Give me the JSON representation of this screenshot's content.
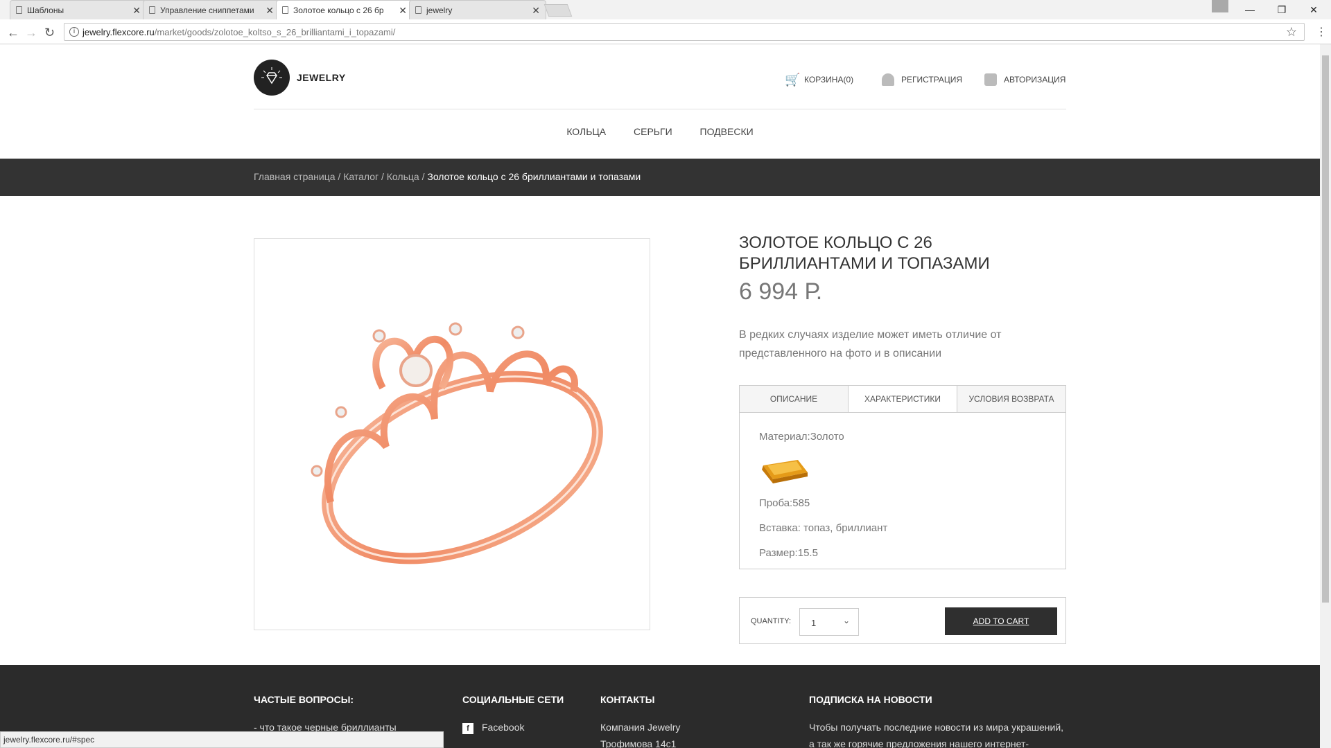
{
  "browser": {
    "tabs": [
      {
        "title": "Шаблоны",
        "active": false
      },
      {
        "title": "Управление сниппетами",
        "active": false
      },
      {
        "title": "Золотое кольцо с 26 бр",
        "active": true
      },
      {
        "title": "jewelry",
        "active": false
      }
    ],
    "url_host": "jewelry.flexcore.ru",
    "url_path": "/market/goods/zolotoe_koltso_s_26_brilliantami_i_topazami/",
    "status_url": "jewelry.flexcore.ru/#spec"
  },
  "header": {
    "logo_text": "JEWELRY",
    "cart": "КОРЗИНА(0)",
    "register": "РЕГИСТРАЦИЯ",
    "login": "АВТОРИЗАЦИЯ"
  },
  "nav": {
    "items": [
      "КОЛЬЦА",
      "СЕРЬГИ",
      "ПОДВЕСКИ"
    ]
  },
  "breadcrumb": {
    "home": "Главная страница",
    "catalog": "Каталог",
    "rings": "Кольца",
    "current": "Золотое кольцо с 26 бриллиантами и топазами",
    "sep": " / "
  },
  "product": {
    "title": "ЗОЛОТОЕ КОЛЬЦО С 26 БРИЛЛИАНТАМИ И ТОПАЗАМИ",
    "price": "6 994 Р.",
    "note": "В редких случаях изделие может иметь отличие от представленного на фото и в описании",
    "tabs": [
      "ОПИСАНИЕ",
      "ХАРАКТЕРИСТИКИ",
      "УСЛОВИЯ ВОЗВРАТА"
    ],
    "specs": {
      "material": "Материал:Золото",
      "proba": "Проба:585",
      "insert": "Вставка: топаз, бриллиант",
      "size": "Размер:15.5"
    },
    "quantity_label": "QUANTITY:",
    "quantity": "1",
    "add_to_cart": "ADD TO CART"
  },
  "footer": {
    "faq_title": "ЧАСТЫЕ ВОПРОСЫ:",
    "faq_item": "- что такое черные бриллианты",
    "social_title": "СОЦИАЛЬНЫЕ СЕТИ",
    "social_item": "Facebook",
    "contacts_title": "КОНТАКТЫ",
    "contacts_line1": "Компания Jewelry",
    "contacts_line2": "Трофимова 14с1",
    "news_title": "ПОДПИСКА НА НОВОСТИ",
    "news_line1": "Чтобы получать последние новости из мира украшений,",
    "news_line2": "а так же горячие предложения нашего интернет-"
  }
}
